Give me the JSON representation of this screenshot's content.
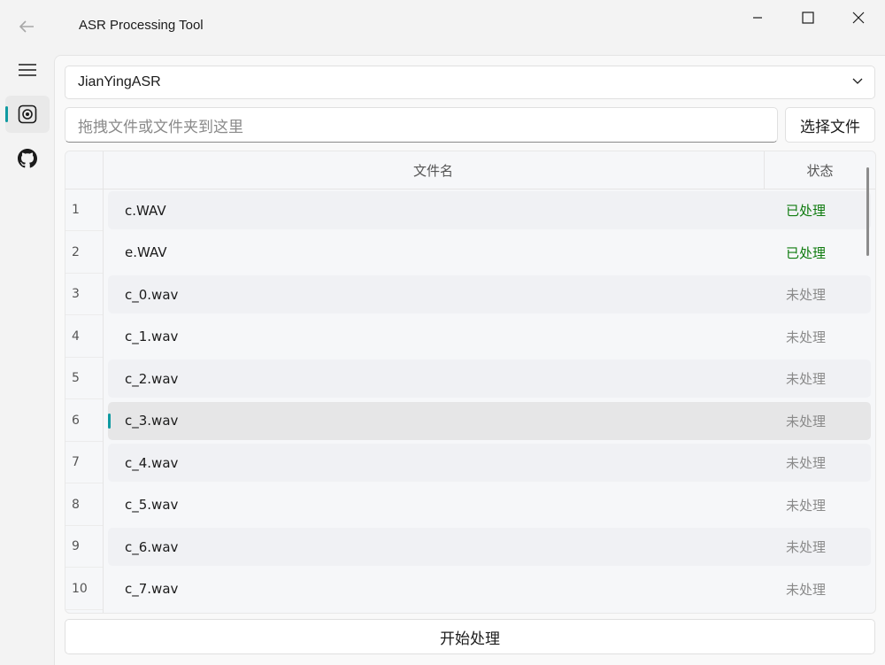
{
  "app": {
    "title": "ASR Processing Tool"
  },
  "nav": {
    "items": [
      {
        "icon": "menu-icon"
      },
      {
        "icon": "record-icon"
      },
      {
        "icon": "github-icon"
      }
    ]
  },
  "engine": {
    "selected": "JianYingASR"
  },
  "drop": {
    "placeholder": "拖拽文件或文件夹到这里",
    "select_label": "选择文件"
  },
  "table": {
    "headers": {
      "name": "文件名",
      "status": "状态"
    },
    "rows": [
      {
        "num": "1",
        "name": "c.WAV",
        "status": "已处理",
        "done": true
      },
      {
        "num": "2",
        "name": "e.WAV",
        "status": "已处理",
        "done": true
      },
      {
        "num": "3",
        "name": "c_0.wav",
        "status": "未处理",
        "done": false
      },
      {
        "num": "4",
        "name": "c_1.wav",
        "status": "未处理",
        "done": false
      },
      {
        "num": "5",
        "name": "c_2.wav",
        "status": "未处理",
        "done": false
      },
      {
        "num": "6",
        "name": "c_3.wav",
        "status": "未处理",
        "done": false
      },
      {
        "num": "7",
        "name": "c_4.wav",
        "status": "未处理",
        "done": false
      },
      {
        "num": "8",
        "name": "c_5.wav",
        "status": "未处理",
        "done": false
      },
      {
        "num": "9",
        "name": "c_6.wav",
        "status": "未处理",
        "done": false
      },
      {
        "num": "10",
        "name": "c_7.wav",
        "status": "未处理",
        "done": false
      }
    ],
    "selected_row": 6
  },
  "actions": {
    "start_label": "开始处理"
  },
  "colors": {
    "accent": "#0f9aa1",
    "done": "#0f7b0f",
    "pending": "#8a8a8a"
  }
}
